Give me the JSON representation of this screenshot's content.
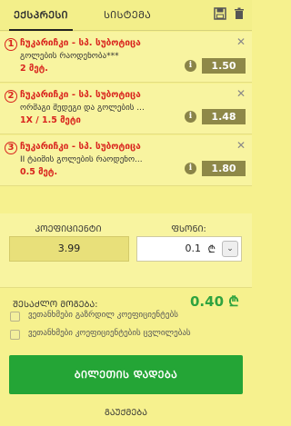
{
  "tabs": {
    "express": "ᲔᲥᲡᲞᲠᲔᲡᲘ",
    "system": "ᲡᲘᲡᲢᲔᲛᲐ"
  },
  "bets": [
    {
      "num": "1",
      "title": "ჩუკარიჩკი - სპ. სუბოტიცა",
      "market": "გოლების რაოდენობა***",
      "selection": "2 მეტ.",
      "odds": "1.50"
    },
    {
      "num": "2",
      "title": "ჩუკარიჩკი - სპ. სუბოტიცა",
      "market": "ორმაგი შედეგი და გოლების ...",
      "selection": "1X / 1.5 მეტი",
      "odds": "1.48"
    },
    {
      "num": "3",
      "title": "ჩუკარიჩკი - სპ. სუბოტიცა",
      "market": "II ტაიმის გოლების რაოდენო...",
      "selection": "0.5 მეტ.",
      "odds": "1.80"
    }
  ],
  "summary": {
    "coef_label": "ᲙᲝᲔᲤᲘᲪᲘᲔᲜᲢᲘ",
    "stake_label": "ᲤᲡᲝᲜᲘ:",
    "coef_value": "3.99",
    "stake_value": "0.1",
    "currency": "₾"
  },
  "max_win": {
    "label": "ᲨᲔᲡᲐᲫᲚᲝ ᲛᲝᲒᲔᲑᲐ:",
    "value": "0.40 ₾"
  },
  "checkboxes": [
    "ვეთანხმები გაზრდილ კოეფიციენტებს",
    "ვეთანხმები კოეფიციენტების ცვლილებას"
  ],
  "place_button": "ᲑᲘᲚᲔᲗᲘᲡ ᲓᲐᲓᲔᲑᲐ",
  "cancel_link": "ᲒᲐᲣᲥᲛᲔᲑᲐ"
}
